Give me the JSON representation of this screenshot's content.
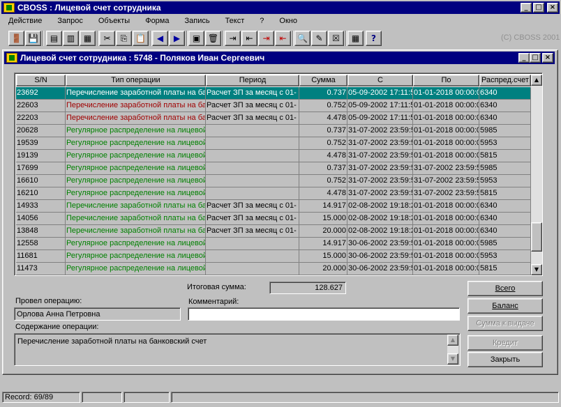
{
  "app": {
    "title": "CBOSS : Лицевой счет сотрудника",
    "copyright": "(C) CBOSS 2001"
  },
  "menu": [
    "Действие",
    "Запрос",
    "Объекты",
    "Форма",
    "Запись",
    "Текст",
    "?",
    "Окно"
  ],
  "toolbar": [
    "exit-icon",
    "save-icon",
    "query-icon",
    "query-run-icon",
    "cut-icon",
    "copy-icon",
    "paste-icon",
    "prev-icon",
    "next-icon",
    "list-icon",
    "trash-icon",
    "insert-record-icon",
    "insert-icon",
    "delete-icon",
    "delete-record-icon",
    "find-icon",
    "edit-icon",
    "cancel-icon",
    "calculator-icon",
    "help-icon"
  ],
  "window": {
    "title": "Лицевой счет сотрудника : 5748 - Поляков Иван Сергеевич"
  },
  "grid": {
    "columns": [
      "S/N",
      "Тип операции",
      "Период",
      "Сумма",
      "С",
      "По",
      "Распред.счет"
    ],
    "rows": [
      {
        "sn": "23692",
        "type": "Перечисление заработной платы на ба",
        "period": "Расчет ЗП за месяц с 01-",
        "sum": "0.737",
        "from": "05-09-2002 17:11:5",
        "to": "01-01-2018 00:00:0",
        "account": "6340",
        "color": "red",
        "selected": true
      },
      {
        "sn": "22603",
        "type": "Перечисление заработной платы на ба",
        "period": "Расчет ЗП за месяц с 01-",
        "sum": "0.752",
        "from": "05-09-2002 17:11:5",
        "to": "01-01-2018 00:00:0",
        "account": "6340",
        "color": "red"
      },
      {
        "sn": "22203",
        "type": "Перечисление заработной платы на ба",
        "period": "Расчет ЗП за месяц с 01-",
        "sum": "4.478",
        "from": "05-09-2002 17:11:5",
        "to": "01-01-2018 00:00:0",
        "account": "6340",
        "color": "red"
      },
      {
        "sn": "20628",
        "type": "Регулярное распределение на лицевой",
        "period": "",
        "sum": "0.737",
        "from": "31-07-2002 23:59:5",
        "to": "01-01-2018 00:00:0",
        "account": "5985",
        "color": "green"
      },
      {
        "sn": "19539",
        "type": "Регулярное распределение на лицевой",
        "period": "",
        "sum": "0.752",
        "from": "31-07-2002 23:59:5",
        "to": "01-01-2018 00:00:0",
        "account": "5953",
        "color": "green"
      },
      {
        "sn": "19139",
        "type": "Регулярное распределение на лицевой",
        "period": "",
        "sum": "4.478",
        "from": "31-07-2002 23:59:5",
        "to": "01-01-2018 00:00:0",
        "account": "5815",
        "color": "green"
      },
      {
        "sn": "17699",
        "type": "Регулярное распределение на лицевой",
        "period": "",
        "sum": "0.737",
        "from": "31-07-2002 23:59:5",
        "to": "31-07-2002 23:59:5",
        "account": "5985",
        "color": "green"
      },
      {
        "sn": "16610",
        "type": "Регулярное распределение на лицевой",
        "period": "",
        "sum": "0.752",
        "from": "31-07-2002 23:59:5",
        "to": "31-07-2002 23:59:5",
        "account": "5953",
        "color": "green"
      },
      {
        "sn": "16210",
        "type": "Регулярное распределение на лицевой",
        "period": "",
        "sum": "4.478",
        "from": "31-07-2002 23:59:5",
        "to": "31-07-2002 23:59:5",
        "account": "5815",
        "color": "green"
      },
      {
        "sn": "14933",
        "type": "Перечисление заработной платы на ба",
        "period": "Расчет ЗП за месяц с 01-",
        "sum": "14.917",
        "from": "02-08-2002 19:18:2",
        "to": "01-01-2018 00:00:0",
        "account": "6340",
        "color": "green"
      },
      {
        "sn": "14056",
        "type": "Перечисление заработной платы на ба",
        "period": "Расчет ЗП за месяц с 01-",
        "sum": "15.000",
        "from": "02-08-2002 19:18:2",
        "to": "01-01-2018 00:00:0",
        "account": "6340",
        "color": "green"
      },
      {
        "sn": "13848",
        "type": "Перечисление заработной платы на ба",
        "period": "Расчет ЗП за месяц с 01-",
        "sum": "20.000",
        "from": "02-08-2002 19:18:2",
        "to": "01-01-2018 00:00:0",
        "account": "6340",
        "color": "green"
      },
      {
        "sn": "12558",
        "type": "Регулярное распределение на лицевой",
        "period": "",
        "sum": "14.917",
        "from": "30-06-2002 23:59:5",
        "to": "01-01-2018 00:00:0",
        "account": "5985",
        "color": "green"
      },
      {
        "sn": "11681",
        "type": "Регулярное распределение на лицевой",
        "period": "",
        "sum": "15.000",
        "from": "30-06-2002 23:59:5",
        "to": "01-01-2018 00:00:0",
        "account": "5953",
        "color": "green"
      },
      {
        "sn": "11473",
        "type": "Регулярное распределение на лицевой",
        "period": "",
        "sum": "20.000",
        "from": "30-06-2002 23:59:5",
        "to": "01-01-2018 00:00:0",
        "account": "5815",
        "color": "green"
      }
    ]
  },
  "form": {
    "total_label": "Итоговая сумма:",
    "total_value": "128.627",
    "operator_label": "Провел операцию:",
    "operator_value": "Орлова Анна Петровна",
    "comment_label": "Комментарий:",
    "comment_value": "",
    "content_label": "Содержание операции:",
    "content_value": "Перечисление заработной платы на банковский счет"
  },
  "buttons": {
    "all": "Всего",
    "balance": "Баланс",
    "payout": "Сумма к выдаче",
    "credit": "Кредит",
    "close": "Закрыть"
  },
  "status": {
    "record": "Record: 69/89"
  },
  "colors": {
    "title_bg": "#000080",
    "selected_row": "#008080",
    "red_text": "#a00000",
    "green_text": "#008000"
  }
}
